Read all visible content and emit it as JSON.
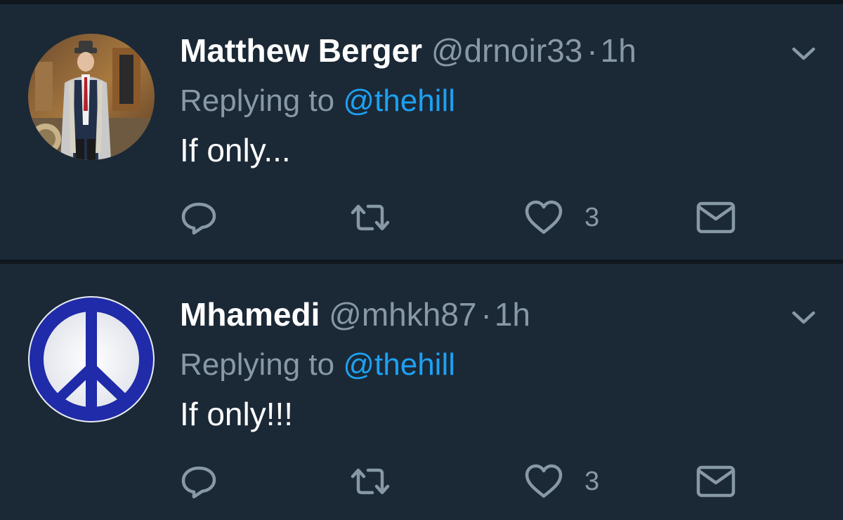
{
  "tweets": [
    {
      "display_name": "Matthew Berger",
      "handle": "@drnoir33",
      "separator": "·",
      "time": "1h",
      "replying_prefix": "Replying to",
      "replying_to": "@thehill",
      "text": "If only...",
      "like_count": "3",
      "avatar": "photo-avatar"
    },
    {
      "display_name": "Mhamedi",
      "handle": "@mhkh87",
      "separator": "·",
      "time": "1h",
      "replying_prefix": "Replying to",
      "replying_to": "@thehill",
      "text": "If only!!!",
      "like_count": "3",
      "avatar": "peace-sign-avatar"
    }
  ],
  "icons": {
    "reply": "reply-icon",
    "retweet": "retweet-icon",
    "like": "heart-icon",
    "dm": "envelope-icon",
    "menu": "chevron-down-icon"
  },
  "colors": {
    "background": "#1b2836",
    "divider": "#10171e",
    "primary_text": "#ffffff",
    "secondary_text": "#8899a6",
    "link": "#1da1f2"
  }
}
